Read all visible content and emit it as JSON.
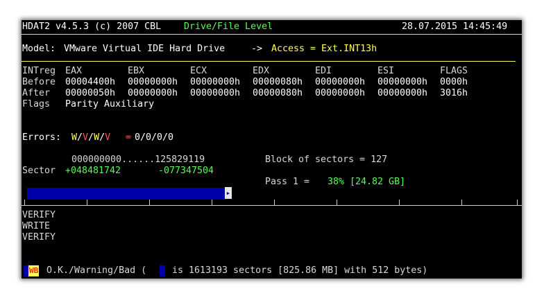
{
  "header": {
    "version": "HDAT2 v4.5.3 (c) 2007 CBL",
    "mode": "Drive/File Level",
    "datetime": "28.07.2015 14:45:49"
  },
  "model": {
    "label": "Model:",
    "name": "VMware Virtual IDE Hard Drive",
    "arrow": "->",
    "access": "Access = Ext.INT13h"
  },
  "registers": {
    "label_col": "INTreg",
    "columns": [
      "EAX",
      "EBX",
      "ECX",
      "EDX",
      "EDI",
      "ESI",
      "FLAGS"
    ],
    "rows": [
      {
        "label": "Before",
        "values": [
          "00004400h",
          "00000000h",
          "00000000h",
          "00000080h",
          "00000000h",
          "00000000h",
          "0000h"
        ]
      },
      {
        "label": "After",
        "values": [
          "00000050h",
          "00000000h",
          "00000000h",
          "00000080h",
          "00000000h",
          "00000000h",
          "3016h"
        ]
      }
    ],
    "flags_label": "Flags",
    "flags_value": "Parity Auxiliary"
  },
  "errors": {
    "label": "Errors:",
    "legend": [
      "W",
      "V",
      "W",
      "V"
    ],
    "equals": "=",
    "values": "0/0/0/0"
  },
  "sector": {
    "range_start": "000000000",
    "range_dots": "......",
    "range_end": "125829119",
    "label": "Sector",
    "current": "+048481742",
    "remaining": "-077347504",
    "block_text": "Block of sectors = 127",
    "pass_label": "Pass 1 =",
    "pass_percent_text": "38% [24.82 GB]",
    "progress_fraction": 0.38,
    "progress_marker": "▸"
  },
  "log": {
    "lines": [
      "VERIFY",
      "WRITE",
      "VERIFY"
    ]
  },
  "footer": {
    "wb_label": "WB",
    "legend_text": "O.K./Warning/Bad (",
    "info_text": "is 1613193 sectors [825.86 MB] with 512 bytes)"
  },
  "colors": {
    "background": "#000000",
    "text": "#d8d8d8",
    "highlight": "#ffff55",
    "green": "#55ff55",
    "red": "#ff5555",
    "progress": "#0000aa",
    "divider": "#ffff55"
  }
}
